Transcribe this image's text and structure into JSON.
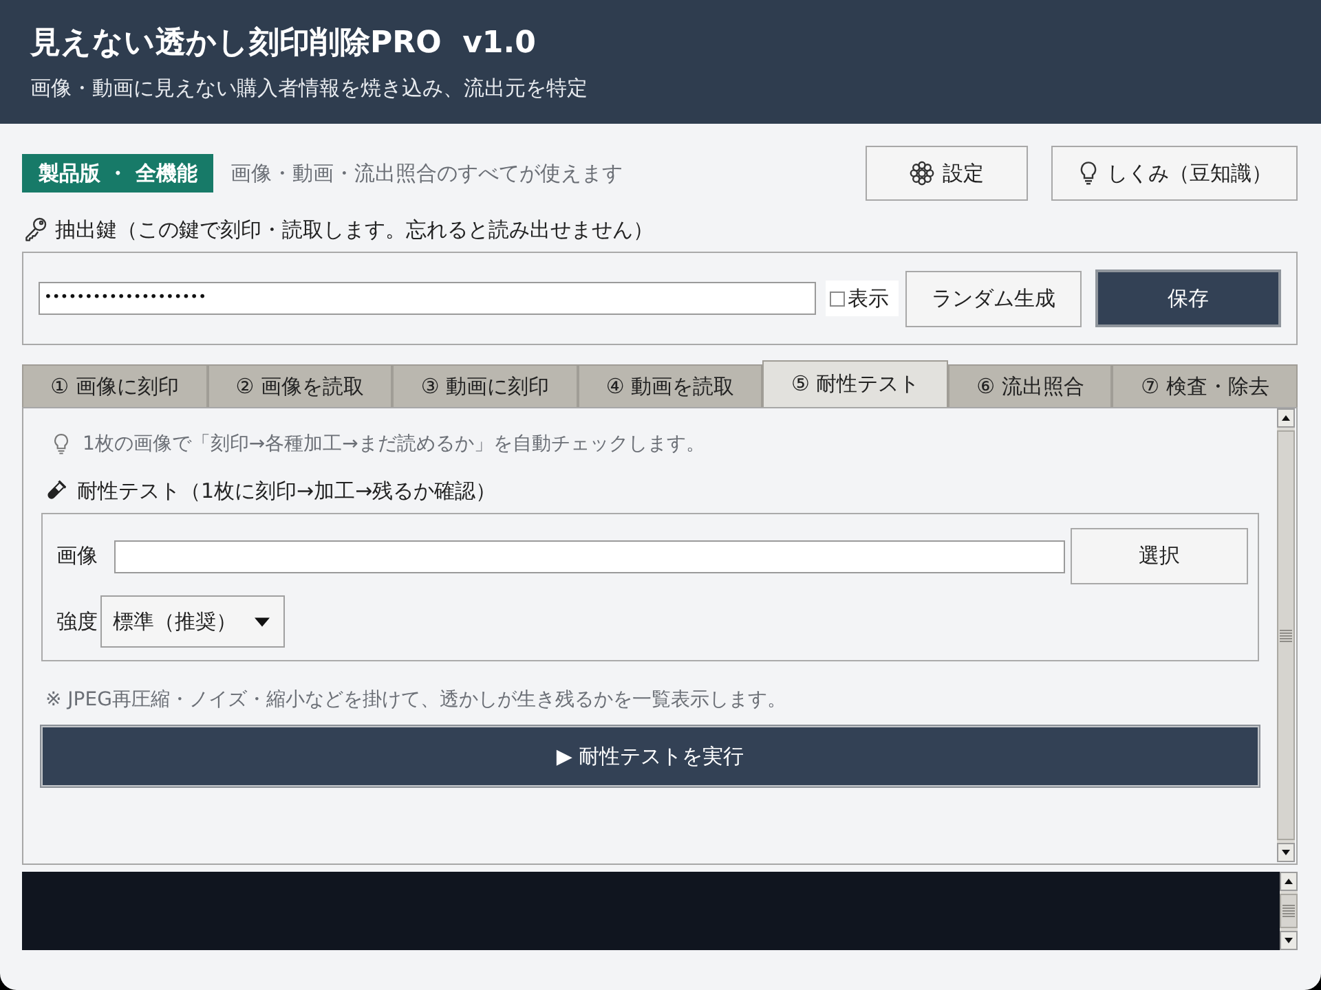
{
  "header": {
    "title": "見えない透かし刻印削除PRO  v1.0",
    "subtitle": "画像・動画に見えない購入者情報を焼き込み、流出元を特定"
  },
  "license": {
    "badge": "製品版 ・ 全機能",
    "description": "画像・動画・流出照合のすべてが使えます"
  },
  "settings_button": {
    "label": "設定"
  },
  "tips_button": {
    "label": "しくみ（豆知識）"
  },
  "key_section": {
    "label": "抽出鍵（この鍵で刻印・読取します。忘れると読み出せません）",
    "value": "••••••••••••••••••••",
    "show_checkbox": {
      "label": "表示",
      "checked": false
    },
    "random_button": "ランダム生成",
    "save_button": "保存"
  },
  "tabs": [
    {
      "label": "① 画像に刻印",
      "selected": false
    },
    {
      "label": "② 画像を読取",
      "selected": false
    },
    {
      "label": "③ 動画に刻印",
      "selected": false
    },
    {
      "label": "④ 動画を読取",
      "selected": false
    },
    {
      "label": "⑤ 耐性テスト",
      "selected": true
    },
    {
      "label": "⑥ 流出照合",
      "selected": false
    },
    {
      "label": "⑦ 検査・除去",
      "selected": false
    }
  ],
  "panel": {
    "hint": "1枚の画像で「刻印→各種加工→まだ読めるか」を自動チェックします。",
    "section_title": "耐性テスト（1枚に刻印→加工→残るか確認）",
    "image_field": {
      "label": "画像"
    },
    "select_button": "選択",
    "strength": {
      "label": "強度",
      "value": "標準（推奨）"
    },
    "note": "※ JPEG再圧縮・ノイズ・縮小などを掛けて、透かしが生き残るかを一覧表示します。",
    "run_button": "▶ 耐性テストを実行"
  }
}
